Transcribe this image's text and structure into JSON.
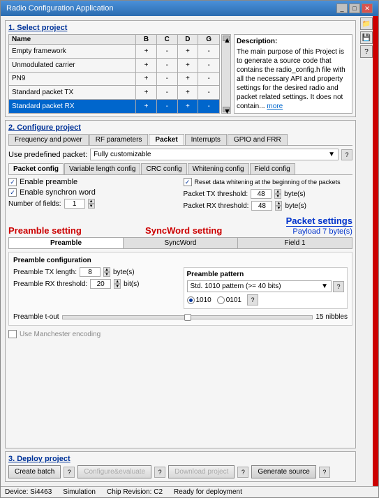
{
  "window": {
    "title": "Radio Configuration Application",
    "controls": [
      "_",
      "□",
      "✕"
    ]
  },
  "section1": {
    "header": "1. Select project",
    "table": {
      "columns": [
        "Name",
        "B",
        "C",
        "D",
        "G"
      ],
      "rows": [
        {
          "name": "Empty framework",
          "B": "+",
          "C": "-",
          "D": "+",
          "G": "-",
          "selected": false
        },
        {
          "name": "Unmodulated carrier",
          "B": "+",
          "C": "-",
          "D": "+",
          "G": "-",
          "selected": false
        },
        {
          "name": "PN9",
          "B": "+",
          "C": "-",
          "D": "+",
          "G": "-",
          "selected": false
        },
        {
          "name": "Standard packet TX",
          "B": "+",
          "C": "-",
          "D": "+",
          "G": "-",
          "selected": false
        },
        {
          "name": "Standard packet RX",
          "B": "+",
          "C": "-",
          "D": "+",
          "G": "-",
          "selected": true
        }
      ]
    },
    "description": {
      "title": "Description:",
      "text": "The main purpose of this Project is to generate a source code that contains the radio_config.h file with all the necessary API and property settings for the desired radio and packet related settings. It does not contain...",
      "more": "more"
    }
  },
  "section2": {
    "header": "2. Configure project",
    "main_tabs": [
      {
        "label": "Frequency and power",
        "active": false
      },
      {
        "label": "RF parameters",
        "active": false
      },
      {
        "label": "Packet",
        "active": true
      },
      {
        "label": "Interrupts",
        "active": false
      },
      {
        "label": "GPIO and FRR",
        "active": false
      }
    ],
    "predefined_label": "Use predefined packet:",
    "predefined_value": "Fully customizable",
    "predefined_help": "?",
    "packet_tabs": [
      {
        "label": "Packet config",
        "active": true
      },
      {
        "label": "Variable length config",
        "active": false
      },
      {
        "label": "CRC config",
        "active": false
      },
      {
        "label": "Whitening config",
        "active": false
      },
      {
        "label": "Field config",
        "active": false
      }
    ],
    "checkboxes": [
      {
        "label": "Enable preamble",
        "checked": true
      },
      {
        "label": "Enable synchron word",
        "checked": true
      }
    ],
    "right_checkboxes": [
      {
        "label": "Reset data whitening at the beginning of the packets",
        "checked": true
      }
    ],
    "fields": {
      "number_of_fields_label": "Number of fields:",
      "number_of_fields_value": "1",
      "packet_tx_threshold_label": "Packet TX threshold:",
      "packet_tx_threshold_value": "48",
      "packet_tx_threshold_unit": "byte(s)",
      "packet_rx_threshold_label": "Packet RX threshold:",
      "packet_rx_threshold_value": "48",
      "packet_rx_threshold_unit": "byte(s)"
    },
    "color_labels": {
      "preamble_setting": "Preamble setting",
      "syncword_setting": "SyncWord setting",
      "packet_settings": "Packet settings",
      "payload": "Payload 7 byte(s)"
    },
    "inner_tabs": [
      {
        "label": "Preamble",
        "active": true
      },
      {
        "label": "SyncWord",
        "active": false
      },
      {
        "label": "Field 1",
        "active": false
      }
    ],
    "preamble_config": {
      "title": "Preamble configuration",
      "tx_length_label": "Preamble TX length:",
      "tx_length_value": "8",
      "tx_length_unit": "byte(s)",
      "rx_threshold_label": "Preamble RX threshold:",
      "rx_threshold_value": "20",
      "rx_threshold_unit": "bit(s)"
    },
    "preamble_pattern": {
      "title": "Preamble pattern",
      "dropdown_value": "Std. 1010 pattern (>= 40 bits)",
      "radio_options": [
        {
          "label": "1010",
          "selected": true
        },
        {
          "label": "0101",
          "selected": false
        }
      ],
      "help": "?"
    },
    "slider": {
      "label": "Preamble t-out",
      "value": "15 nibbles"
    },
    "manchester": {
      "label": "Use Manchester encoding"
    }
  },
  "section3": {
    "header": "3. Deploy project",
    "buttons": [
      {
        "label": "Create batch",
        "disabled": false
      },
      {
        "label": "?",
        "disabled": false
      },
      {
        "label": "Configure&evaluate",
        "disabled": true
      },
      {
        "label": "?",
        "disabled": false
      },
      {
        "label": "Download project",
        "disabled": true
      },
      {
        "label": "?",
        "disabled": false
      },
      {
        "label": "Generate source",
        "disabled": false
      },
      {
        "label": "?",
        "disabled": false
      }
    ]
  },
  "status_bar": {
    "device": "Device: Si4463",
    "simulation": "Simulation",
    "chip_revision": "Chip Revision: C2",
    "ready": "Ready for deployment"
  }
}
